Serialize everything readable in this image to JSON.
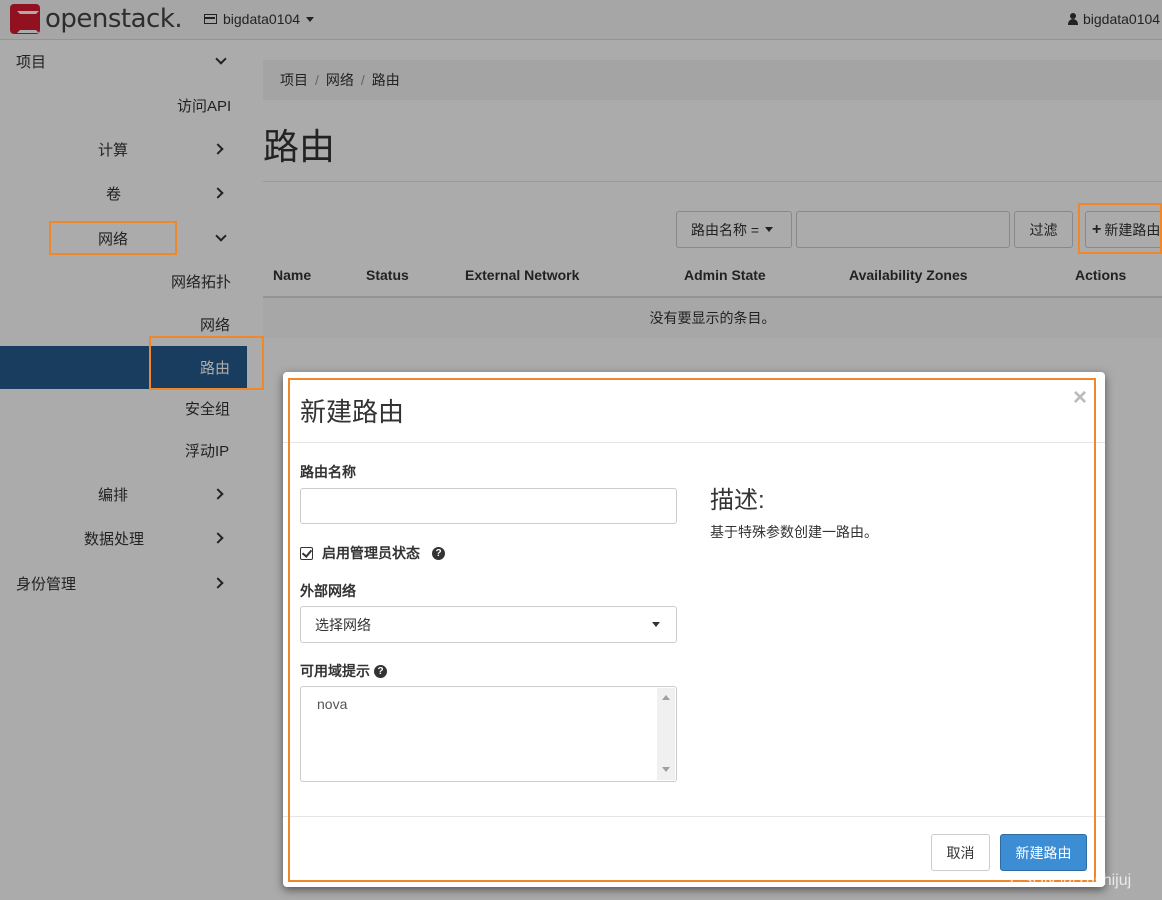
{
  "navbar": {
    "brand": "openstack.",
    "project": "bigdata0104",
    "user": "bigdata0104"
  },
  "sidebar": {
    "project": "项目",
    "api_access": "访问API",
    "compute": "计算",
    "volumes": "卷",
    "network": "网络",
    "network_topology": "网络拓扑",
    "networks": "网络",
    "routers": "路由",
    "security_groups": "安全组",
    "floating_ips": "浮动IP",
    "orchestration": "编排",
    "data_processing": "数据处理",
    "identity": "身份管理"
  },
  "breadcrumb": {
    "items": [
      "项目",
      "网络",
      "路由"
    ],
    "separator": "/"
  },
  "page": {
    "title": "路由",
    "filter_field": "路由名称 =",
    "filter_button": "过滤",
    "create_button": "新建路由"
  },
  "table": {
    "columns": [
      "Name",
      "Status",
      "External Network",
      "Admin State",
      "Availability Zones",
      "Actions"
    ],
    "empty_message": "没有要显示的条目。"
  },
  "modal": {
    "title": "新建路由",
    "close": "×",
    "router_name_label": "路由名称",
    "router_name_value": "",
    "admin_state_label": "启用管理员状态",
    "admin_state_checked": true,
    "external_network_label": "外部网络",
    "external_network_value": "选择网络",
    "az_hints_label": "可用域提示",
    "az_hints_options": [
      "nova"
    ],
    "description_title": "描述:",
    "description_text": "基于特殊参数创建一路由。",
    "cancel_button": "取消",
    "submit_button": "新建路由"
  },
  "colors": {
    "highlight": "#f0882a",
    "primary_button": "#3c8dd3",
    "sidebar_active": "#245c8e"
  },
  "watermark": "CSDN @Yushijuj"
}
